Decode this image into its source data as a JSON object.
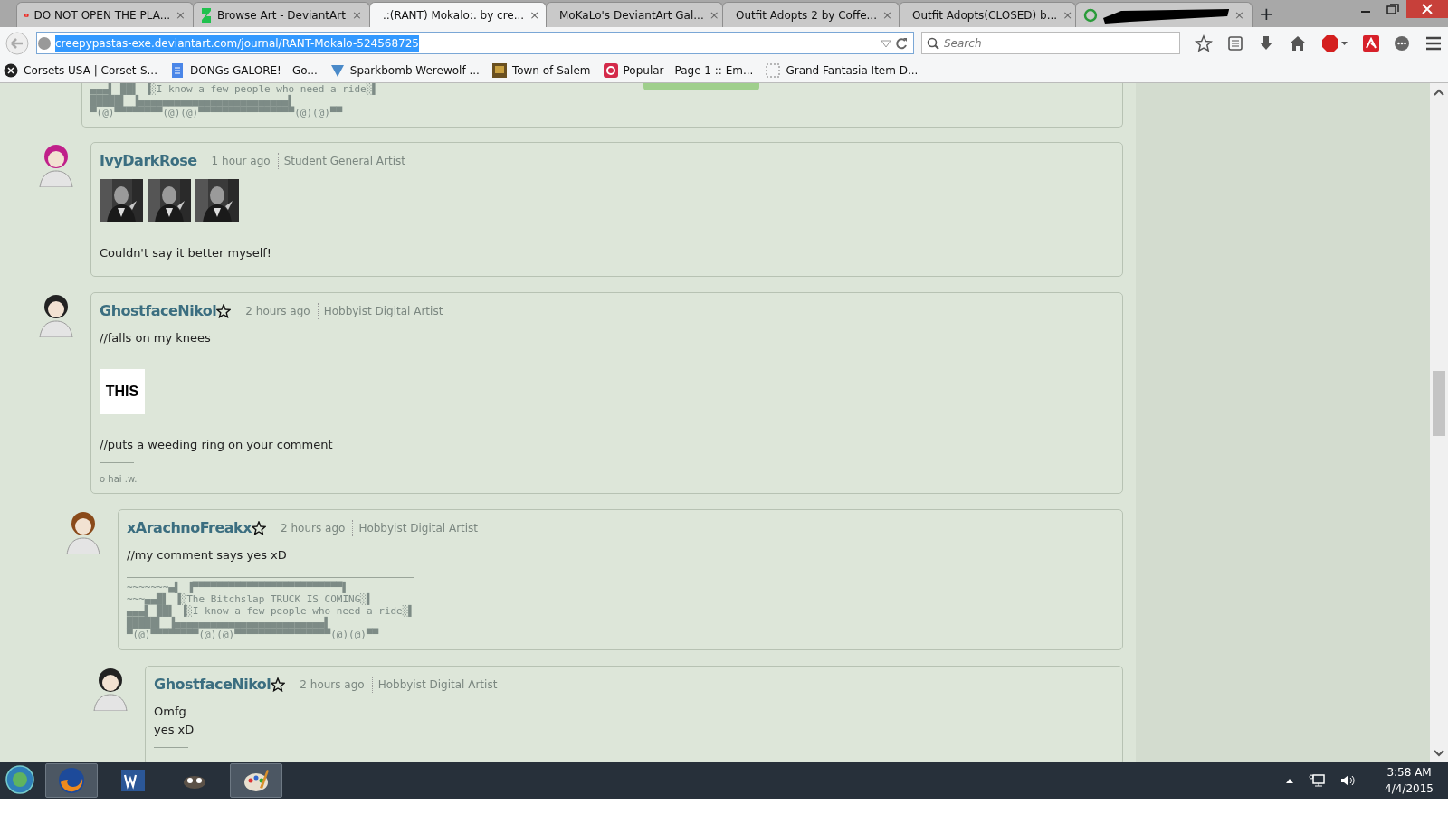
{
  "browser": {
    "tabs": [
      {
        "title": "DO NOT OPEN THE PLA...",
        "kind": "video",
        "close": "×",
        "selected": false
      },
      {
        "title": "Browse Art - DeviantArt",
        "kind": "deviantart",
        "close": "×",
        "selected": false
      },
      {
        "title": ".:(RANT) Mokalo:. by cre...",
        "kind": "deviantart",
        "close": "×",
        "selected": true
      },
      {
        "title": "MoKaLo's DeviantArt Gal...",
        "kind": "deviantart",
        "close": "×",
        "selected": false
      },
      {
        "title": "Outfit Adopts 2 by Coffe...",
        "kind": "deviantart",
        "close": "×",
        "selected": false
      },
      {
        "title": "Outfit Adopts(CLOSED) b...",
        "kind": "deviantart",
        "close": "×",
        "selected": false
      },
      {
        "kind": "loading",
        "close": "×",
        "selected": false,
        "redacted": true
      }
    ],
    "new_tab": "+",
    "address": "creepypastas-exe.deviantart.com/journal/RANT-Mokalo-524568725",
    "search": {
      "placeholder": "Search"
    },
    "bookmarks": [
      {
        "label": "Corsets USA | Corset-S..."
      },
      {
        "label": "DONGs GALORE! - Go..."
      },
      {
        "label": "Sparkbomb Werewolf ..."
      },
      {
        "label": "Town of Salem"
      },
      {
        "label": "Popular - Page 1 :: Em..."
      },
      {
        "label": "Grand Fantasia Item D..."
      }
    ]
  },
  "top_fragment": {
    "ascii": [
      "▄▄▄▌ ██▌ ▐░I know a few people who need a ride░▌",
      "█████▌ ▐▄▄▄▄▄▄▄▄▄▄▄▄▄▄▄▄▄▄▄▄▄▄▄▄▄▌",
      "▀(@)▀▀▀▀▀▀▀▀(@)(@)▀▀▀▀▀▀▀▀▀▀▀▀▀▀▀▀(@)(@)▀▀"
    ]
  },
  "comments": [
    {
      "username": "IvyDarkRose",
      "star": false,
      "time": "1 hour ago",
      "rank": "Student General Artist",
      "body": [
        {
          "kind": "thumbs"
        },
        {
          "kind": "text",
          "text": "Couldn't say it better myself!"
        }
      ]
    },
    {
      "username": "GhostfaceNikol",
      "star": true,
      "time": "2 hours ago",
      "rank": "Hobbyist Digital Artist",
      "body": [
        {
          "kind": "text",
          "text": "//falls on my knees"
        },
        {
          "kind": "image_text",
          "text": "THIS"
        },
        {
          "kind": "text",
          "text": "//puts a weeding ring on your comment"
        },
        {
          "kind": "rule"
        },
        {
          "kind": "signature",
          "text": "o hai .w."
        }
      ],
      "children": [
        {
          "username": "xArachnoFreakx",
          "star": true,
          "time": "2 hours ago",
          "rank": "Hobbyist Digital Artist",
          "body": [
            {
              "kind": "text",
              "text": "//my comment says yes xD"
            },
            {
              "kind": "ascii",
              "lines": [
                "~~~~~~~▄▌ ▐▀▀▀▀▀▀▀▀▀▀▀▀▀▀▀▀▀▀▀▀▀▀▀▀▀▌",
                "~~~▄▄█▌ ▐░The Bitchslap TRUCK IS COMING░▌",
                "▄▄▄▌ ██▌ ▐░I know a few people who need a ride░▌",
                "█████▌ ▐▄▄▄▄▄▄▄▄▄▄▄▄▄▄▄▄▄▄▄▄▄▄▄▄▄▌",
                "▀(@)▀▀▀▀▀▀▀▀(@)(@)▀▀▀▀▀▀▀▀▀▀▀▀▀▀▀▀(@)(@)▀▀"
              ]
            }
          ],
          "children": [
            {
              "username": "GhostfaceNikol",
              "star": true,
              "time": "2 hours ago",
              "rank": "Hobbyist Digital Artist",
              "body": [
                {
                  "kind": "text",
                  "text": "Omfg\nyes xD"
                },
                {
                  "kind": "rule"
                }
              ]
            }
          ]
        }
      ]
    }
  ],
  "taskbar": {
    "apps": [
      {
        "selected": true
      },
      {
        "selected": false
      },
      {
        "selected": false
      },
      {
        "selected": true
      }
    ],
    "time": "3:58 AM",
    "date": "4/4/2015"
  }
}
